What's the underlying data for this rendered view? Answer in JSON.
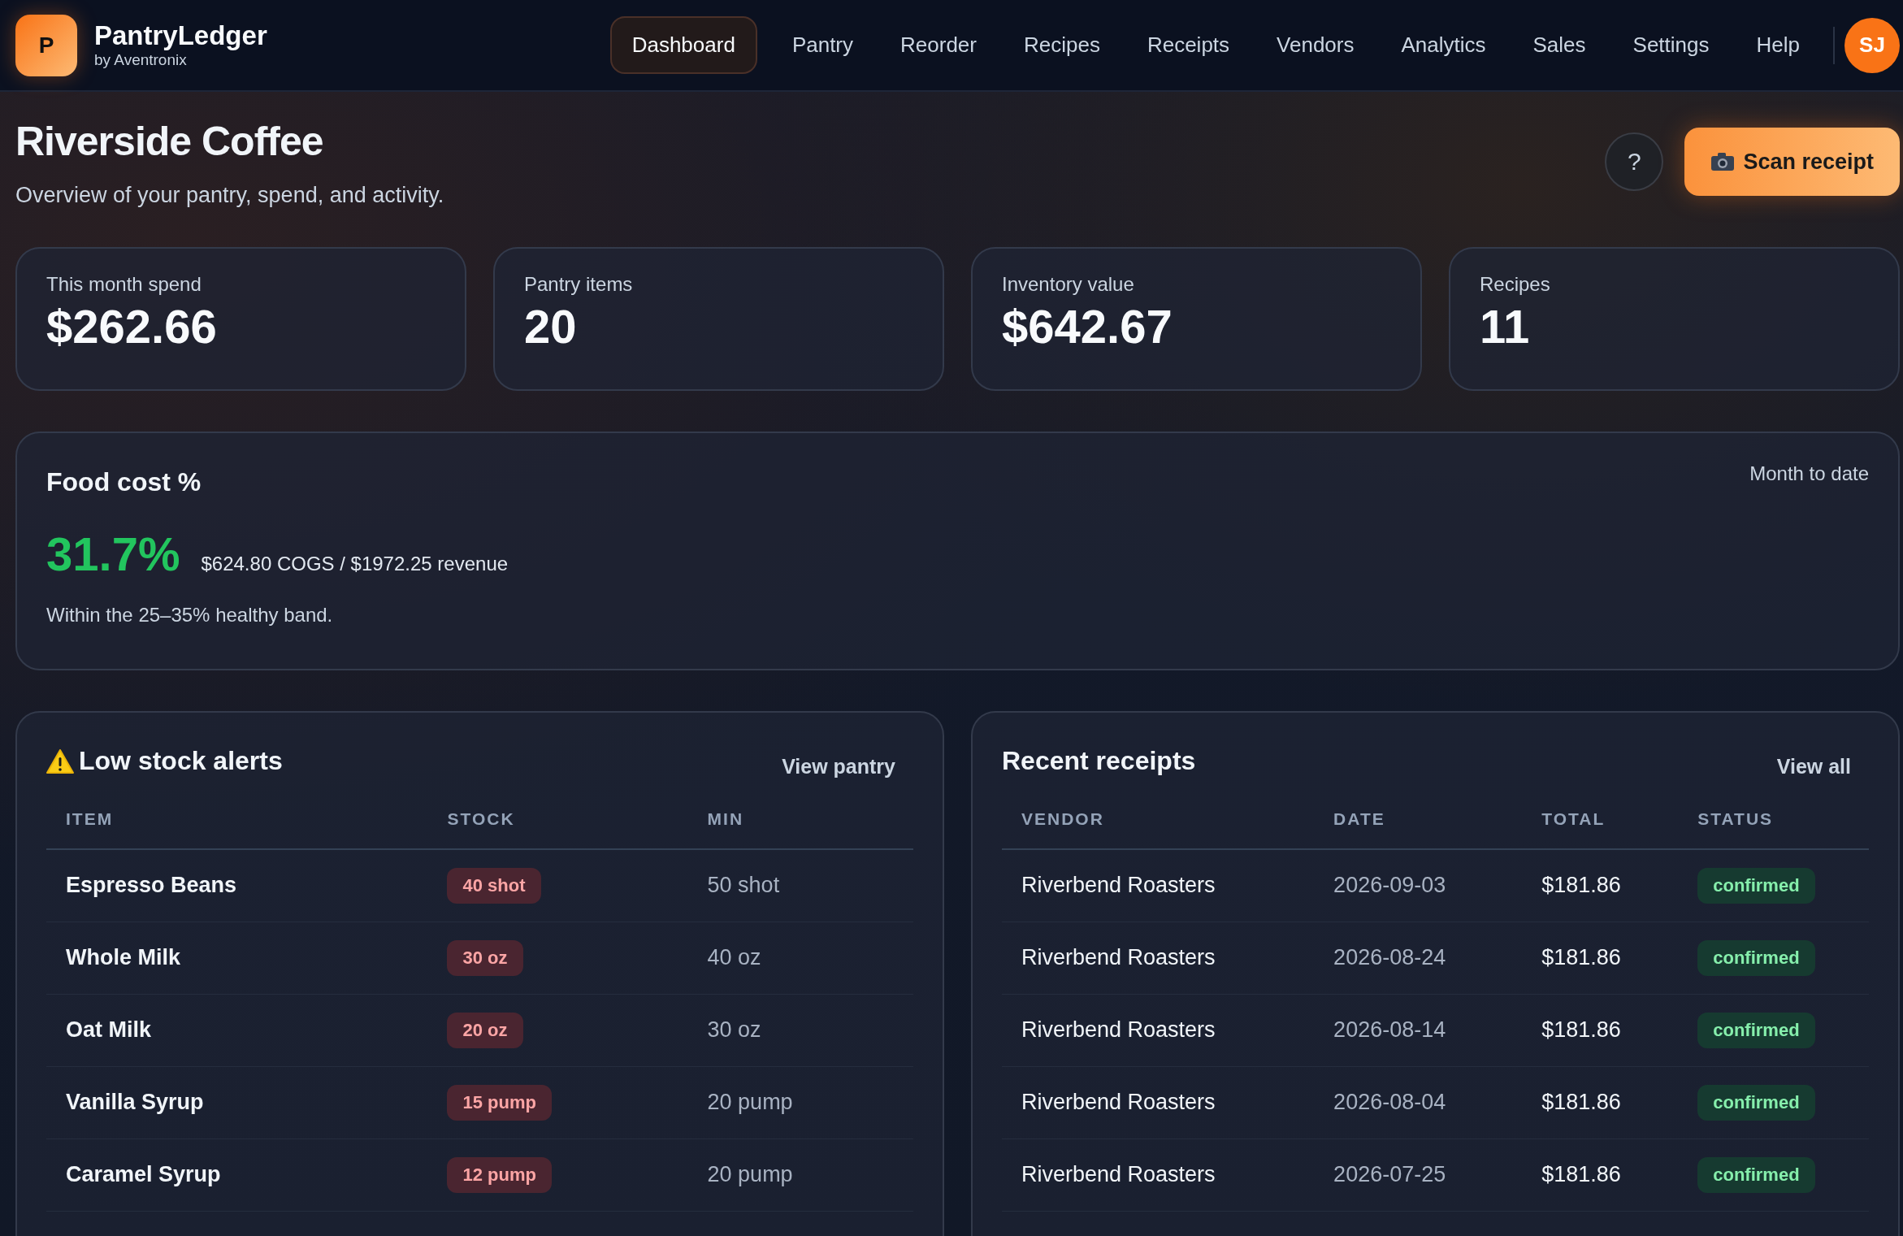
{
  "app": {
    "logo_letter": "P",
    "name": "PantryLedger",
    "byline": "by Aventronix"
  },
  "nav": [
    {
      "label": "Dashboard",
      "selected": true
    },
    {
      "label": "Pantry",
      "selected": false
    },
    {
      "label": "Reorder",
      "selected": false
    },
    {
      "label": "Recipes",
      "selected": false
    },
    {
      "label": "Receipts",
      "selected": false
    },
    {
      "label": "Vendors",
      "selected": false
    },
    {
      "label": "Analytics",
      "selected": false
    },
    {
      "label": "Sales",
      "selected": false
    },
    {
      "label": "Settings",
      "selected": false
    },
    {
      "label": "Help",
      "selected": false
    }
  ],
  "avatar": "SJ",
  "page": {
    "title": "Riverside Coffee",
    "subtitle": "Overview of your pantry, spend, and activity.",
    "help_button": "?",
    "scan_button": "Scan receipt"
  },
  "stats": [
    {
      "label": "This month spend",
      "value": "$262.66"
    },
    {
      "label": "Pantry items",
      "value": "20"
    },
    {
      "label": "Inventory value",
      "value": "$642.67"
    },
    {
      "label": "Recipes",
      "value": "11"
    }
  ],
  "food_cost": {
    "title": "Food cost %",
    "period": "Month to date",
    "percent": "31.7%",
    "detail": "$624.80 COGS / $1972.25 revenue",
    "note": "Within the 25–35% healthy band."
  },
  "low_stock": {
    "title": "Low stock alerts",
    "link": "View pantry",
    "columns": [
      "ITEM",
      "STOCK",
      "MIN"
    ],
    "rows": [
      {
        "item": "Espresso Beans",
        "stock": "40 shot",
        "min": "50 shot"
      },
      {
        "item": "Whole Milk",
        "stock": "30 oz",
        "min": "40 oz"
      },
      {
        "item": "Oat Milk",
        "stock": "20 oz",
        "min": "30 oz"
      },
      {
        "item": "Vanilla Syrup",
        "stock": "15 pump",
        "min": "20 pump"
      },
      {
        "item": "Caramel Syrup",
        "stock": "12 pump",
        "min": "20 pump"
      }
    ]
  },
  "receipts": {
    "title": "Recent receipts",
    "link": "View all",
    "columns": [
      "VENDOR",
      "DATE",
      "TOTAL",
      "STATUS"
    ],
    "rows": [
      {
        "vendor": "Riverbend Roasters",
        "date": "2026-09-03",
        "total": "$181.86",
        "status": "confirmed"
      },
      {
        "vendor": "Riverbend Roasters",
        "date": "2026-08-24",
        "total": "$181.86",
        "status": "confirmed"
      },
      {
        "vendor": "Riverbend Roasters",
        "date": "2026-08-14",
        "total": "$181.86",
        "status": "confirmed"
      },
      {
        "vendor": "Riverbend Roasters",
        "date": "2026-08-04",
        "total": "$181.86",
        "status": "confirmed"
      },
      {
        "vendor": "Riverbend Roasters",
        "date": "2026-07-25",
        "total": "$181.86",
        "status": "confirmed"
      }
    ]
  }
}
